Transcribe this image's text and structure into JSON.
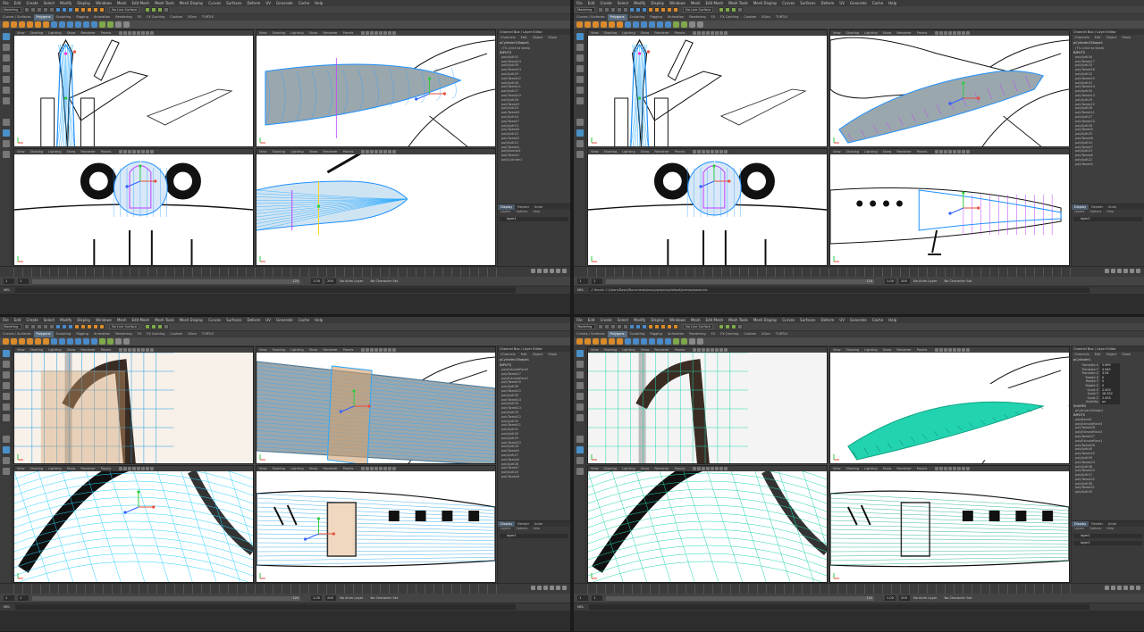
{
  "menus": [
    "File",
    "Edit",
    "Create",
    "Select",
    "Modify",
    "Display",
    "Windows",
    "Mesh",
    "Edit Mesh",
    "Mesh Tools",
    "Mesh Display",
    "Curves",
    "Surfaces",
    "Deform",
    "UV",
    "Generate",
    "Cache",
    "Help"
  ],
  "mode": "Modeling",
  "live_surface": "No Live Surface",
  "shelf_tabs": [
    "Curves / Surfaces",
    "Polygons",
    "Sculpting",
    "Rigging",
    "Animation",
    "Rendering",
    "FX",
    "FX Caching",
    "Custom",
    "XGen",
    "TURTLE"
  ],
  "active_shelf_tab": "Polygons",
  "viewport_menu": [
    "View",
    "Shading",
    "Lighting",
    "Show",
    "Renderer",
    "Panels"
  ],
  "channel_box": {
    "title": "Channel Box / Layer Editor",
    "tabs": [
      "Channels",
      "Edit",
      "Object",
      "Show"
    ],
    "shapes_label": "SHAPES",
    "inputs_label": "INPUTS"
  },
  "layer_panel": {
    "tabs": [
      "Display",
      "Render",
      "Anim"
    ],
    "menu": [
      "Layers",
      "Options",
      "Help"
    ]
  },
  "timeline": {
    "start": "1",
    "current": "1",
    "range_start": "1.00",
    "range_end": "120",
    "anim_end": "200",
    "anim_layer": "No Anim Layer",
    "char_set": "No Character Set"
  },
  "cmd": {
    "label": "MEL",
    "result": "// Result: C:/Users/David/Documents/maya/projects/default/scenes/wasie.mb"
  },
  "quadrants": [
    {
      "object": "pCylinder1Shape1",
      "note": "(7% (click to show)",
      "attrs": [],
      "shapes": [],
      "inputs": [
        "polySplit31",
        "polyTweak14",
        "polySplit30",
        "polyTweak13",
        "polySplit29",
        "polyTweak12",
        "polySplit28",
        "polyTweak11",
        "polySplit27",
        "polyTweak10",
        "polySplit26",
        "polyTweak9",
        "polySplit25",
        "polyTweak8",
        "polySplit24",
        "polyTweak7",
        "polySplit23",
        "polyTweak6",
        "polySplit22",
        "polyTweak5",
        "polySplit21",
        "polyTweak4",
        "polyNormal1",
        "polyTweak3",
        "polyCylinder1"
      ],
      "layers": [
        "layer1"
      ],
      "show_result": false
    },
    {
      "object": "pCylinder1Shape1",
      "note": "(7% (click to show)",
      "attrs": [],
      "shapes": [],
      "inputs": [
        "polySplit34",
        "polyTweak17",
        "polySplit33",
        "polyTweak16",
        "polySplit32",
        "polyTweak15",
        "polySplit31",
        "polyTweak14",
        "polySplit30",
        "polyTweak13",
        "polySplit29",
        "polyTweak12",
        "polySplit28",
        "polyTweak11",
        "polySplit27",
        "polyTweak10",
        "polySplit26",
        "polyTweak9",
        "polySplit25",
        "polyTweak8",
        "polySplit24",
        "polyTweak7",
        "polySplit23",
        "polyTweak6",
        "polySplit22",
        "polyTweak5"
      ],
      "layers": [
        "layer1"
      ],
      "show_result": true
    },
    {
      "object": "pCylinder1Shape1",
      "note": "",
      "attrs": [],
      "shapes": [],
      "inputs": [
        "polyExtrudeFace2",
        "polyTweak17",
        "polyExtrudeFace1",
        "polyTweak16",
        "polySplit36",
        "polyTweak15",
        "polySplit35",
        "polyTweak14",
        "polySplit34",
        "polyTweak13",
        "polySplit33",
        "polyTweak12",
        "polySplit32",
        "polyTweak11",
        "polySplit31",
        "polySplit30",
        "polySplit29",
        "polyTweak10",
        "polySplit28",
        "polyTweak9",
        "polySplit27",
        "polyTweak8",
        "polySplit26",
        "polyTweak7",
        "polySplit25",
        "polyTweak6",
        "polySplit24"
      ],
      "layers": [
        "layer1"
      ],
      "show_result": false
    },
    {
      "object": "pCylinder1",
      "note": "",
      "attrs": [
        [
          "Translate X",
          "5.699"
        ],
        [
          "Translate Y",
          "4.945"
        ],
        [
          "Translate Z",
          "3.54"
        ],
        [
          "Rotate X",
          "0"
        ],
        [
          "Rotate Y",
          "0"
        ],
        [
          "Rotate Z",
          "0"
        ],
        [
          "Scale X",
          "2.453"
        ],
        [
          "Scale Y",
          "18.352"
        ],
        [
          "Scale Z",
          "2.453"
        ],
        [
          "Visibility",
          "on"
        ]
      ],
      "shapes": [
        "pCylinder1Shape1"
      ],
      "inputs": [
        "polyBevel1",
        "polyExtrudeFace3",
        "polyTweak28",
        "polyExtrudeFace2",
        "polyTweak27",
        "polyExtrudeFace1",
        "polyTweak26",
        "polySplit40",
        "polyTweak25",
        "polySplit39",
        "polyTweak24",
        "polySplit38",
        "polyTweak23",
        "polySplit37",
        "polyTweak22",
        "polySplit36",
        "polyTweak21",
        "polySplit35",
        "polyTweak20",
        "polySplit34",
        "polyTweak19",
        "polySplit33",
        "polyTweak18"
      ],
      "layers": [
        "layer1",
        "layer2"
      ],
      "show_result": false
    }
  ]
}
